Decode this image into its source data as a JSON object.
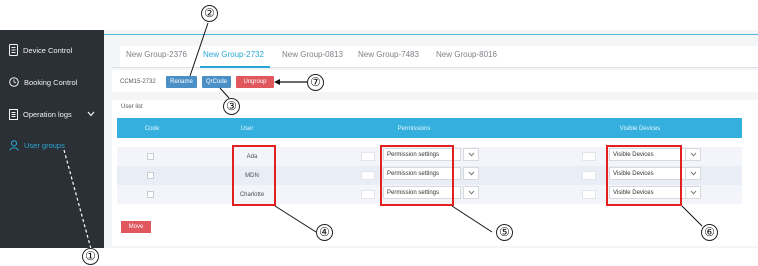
{
  "sidebar": {
    "items": [
      {
        "label": "Device Control",
        "icon": "device-icon",
        "active": false
      },
      {
        "label": "Booking Control",
        "icon": "clock-icon",
        "active": false
      },
      {
        "label": "Operation logs",
        "icon": "document-icon",
        "active": false
      },
      {
        "label": "User groups",
        "icon": "user-icon",
        "active": true
      }
    ]
  },
  "tabs": [
    "New Group-2376",
    "New Group-2732",
    "New Group-0813",
    "New Group-7483",
    "New Group-8016"
  ],
  "active_tab": "New Group-2732",
  "toolbar": {
    "group_code": "CCM15-2732",
    "rename_label": "Rename",
    "qrcode_label": "QrCode",
    "ungroup_label": "Ungroup"
  },
  "card_title": "User list",
  "table": {
    "headers": [
      "Code",
      "User",
      "Permissions",
      "Visible Devices"
    ],
    "rows": [
      {
        "user": "Ada",
        "permission": "Permission settings",
        "devices": "Visible Devices"
      },
      {
        "user": "MDN",
        "permission": "Permission settings",
        "devices": "Visible Devices"
      },
      {
        "user": "Charlotte",
        "permission": "Permission settings",
        "devices": "Visible Devices"
      }
    ]
  },
  "move_label": "Move",
  "callouts": [
    "②",
    "③",
    "⑦",
    "④",
    "⑤",
    "⑥",
    "①"
  ],
  "colors": {
    "sidebar_bg": "#2a3036",
    "accent": "#2aa7d6",
    "header_bg": "#35b0de",
    "button_blue": "#4a90c7",
    "button_red": "#e0575e",
    "highlight": "#e32020"
  }
}
